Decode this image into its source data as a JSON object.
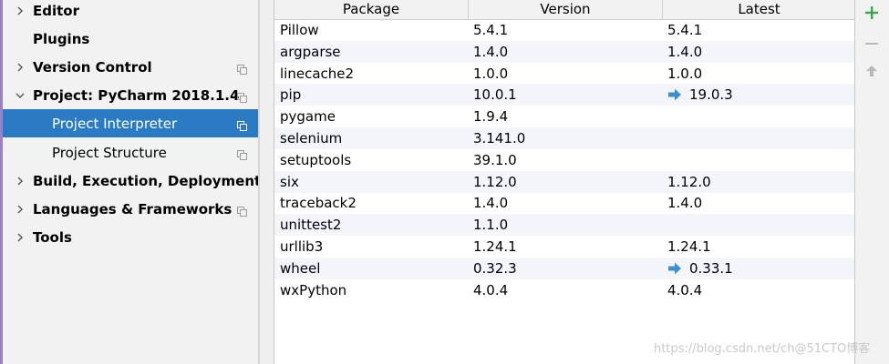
{
  "sidebar": {
    "items": [
      {
        "label": "Editor",
        "chevron": "right",
        "bold": true,
        "copy_icon": false
      },
      {
        "label": "Plugins",
        "chevron": "none",
        "bold": true,
        "copy_icon": false
      },
      {
        "label": "Version Control",
        "chevron": "right",
        "bold": true,
        "copy_icon": true
      },
      {
        "label": "Project: PyCharm 2018.1.4",
        "chevron": "down",
        "bold": true,
        "copy_icon": true
      },
      {
        "label": "Project Interpreter",
        "chevron": "none",
        "bold": false,
        "copy_icon": true,
        "selected": true
      },
      {
        "label": "Project Structure",
        "chevron": "none",
        "bold": false,
        "copy_icon": true
      },
      {
        "label": "Build, Execution, Deployment",
        "chevron": "right",
        "bold": true,
        "copy_icon": false
      },
      {
        "label": "Languages & Frameworks",
        "chevron": "right",
        "bold": true,
        "copy_icon": true
      },
      {
        "label": "Tools",
        "chevron": "right",
        "bold": true,
        "copy_icon": false
      }
    ]
  },
  "table": {
    "headers": [
      "Package",
      "Version",
      "Latest"
    ],
    "rows": [
      {
        "package": "Pillow",
        "version": "5.4.1",
        "latest": "5.4.1",
        "upgrade": false
      },
      {
        "package": "argparse",
        "version": "1.4.0",
        "latest": "1.4.0",
        "upgrade": false
      },
      {
        "package": "linecache2",
        "version": "1.0.0",
        "latest": "1.0.0",
        "upgrade": false
      },
      {
        "package": "pip",
        "version": "10.0.1",
        "latest": "19.0.3",
        "upgrade": true
      },
      {
        "package": "pygame",
        "version": "1.9.4",
        "latest": "",
        "upgrade": false
      },
      {
        "package": "selenium",
        "version": "3.141.0",
        "latest": "",
        "upgrade": false
      },
      {
        "package": "setuptools",
        "version": "39.1.0",
        "latest": "",
        "upgrade": false
      },
      {
        "package": "six",
        "version": "1.12.0",
        "latest": "1.12.0",
        "upgrade": false
      },
      {
        "package": "traceback2",
        "version": "1.4.0",
        "latest": "1.4.0",
        "upgrade": false
      },
      {
        "package": "unittest2",
        "version": "1.1.0",
        "latest": "",
        "upgrade": false
      },
      {
        "package": "urllib3",
        "version": "1.24.1",
        "latest": "1.24.1",
        "upgrade": false
      },
      {
        "package": "wheel",
        "version": "0.32.3",
        "latest": "0.33.1",
        "upgrade": true
      },
      {
        "package": "wxPython",
        "version": "4.0.4",
        "latest": "4.0.4",
        "upgrade": false
      }
    ]
  },
  "toolbar": {
    "add_icon": "plus-icon",
    "remove_icon": "minus-icon",
    "upgrade_icon": "arrow-up-icon"
  },
  "watermark": "https://blog.csdn.net/ch@51CTO博客",
  "colors": {
    "selection": "#2a7bc4",
    "upgrade_arrow": "#3d8fd1",
    "add_green": "#3aa64a"
  }
}
